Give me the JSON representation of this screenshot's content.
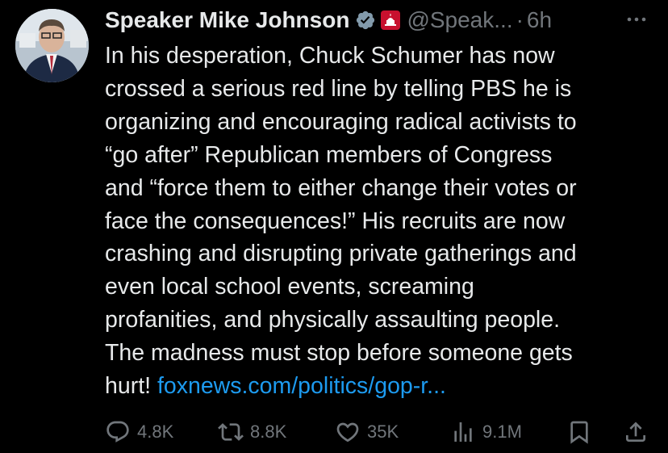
{
  "author": {
    "name": "Speaker Mike Johnson",
    "handle": "@Speak...",
    "separator": "·",
    "time": "6h"
  },
  "tweet": {
    "lines": [
      "In his desperation, Chuck Schumer has now",
      "crossed a serious red line by telling PBS he is",
      "organizing and encouraging radical activists to",
      "“go after” Republican members of Congress",
      "and “force them to either change their votes or",
      "face the consequences!” His recruits are now",
      "crashing and disrupting private gatherings and",
      "even local school events, screaming",
      "profanities, and physically assaulting people.",
      "The madness must stop before someone gets"
    ],
    "last_line_text": "hurt! ",
    "link_text": "foxnews.com/politics/gop-r..."
  },
  "actions": {
    "reply_count": "4.8K",
    "retweet_count": "8.8K",
    "like_count": "35K",
    "view_count": "9.1M"
  },
  "colors": {
    "background": "#000000",
    "text": "#e7e9ea",
    "muted": "#71767b",
    "link": "#1d9bf0",
    "verified": "#829aab",
    "affiliate": "#c8102e"
  },
  "icons": [
    "verified-badge-icon",
    "capitol-affiliate-icon",
    "more-icon",
    "reply-icon",
    "retweet-icon",
    "like-icon",
    "views-icon",
    "bookmark-icon",
    "share-icon"
  ]
}
